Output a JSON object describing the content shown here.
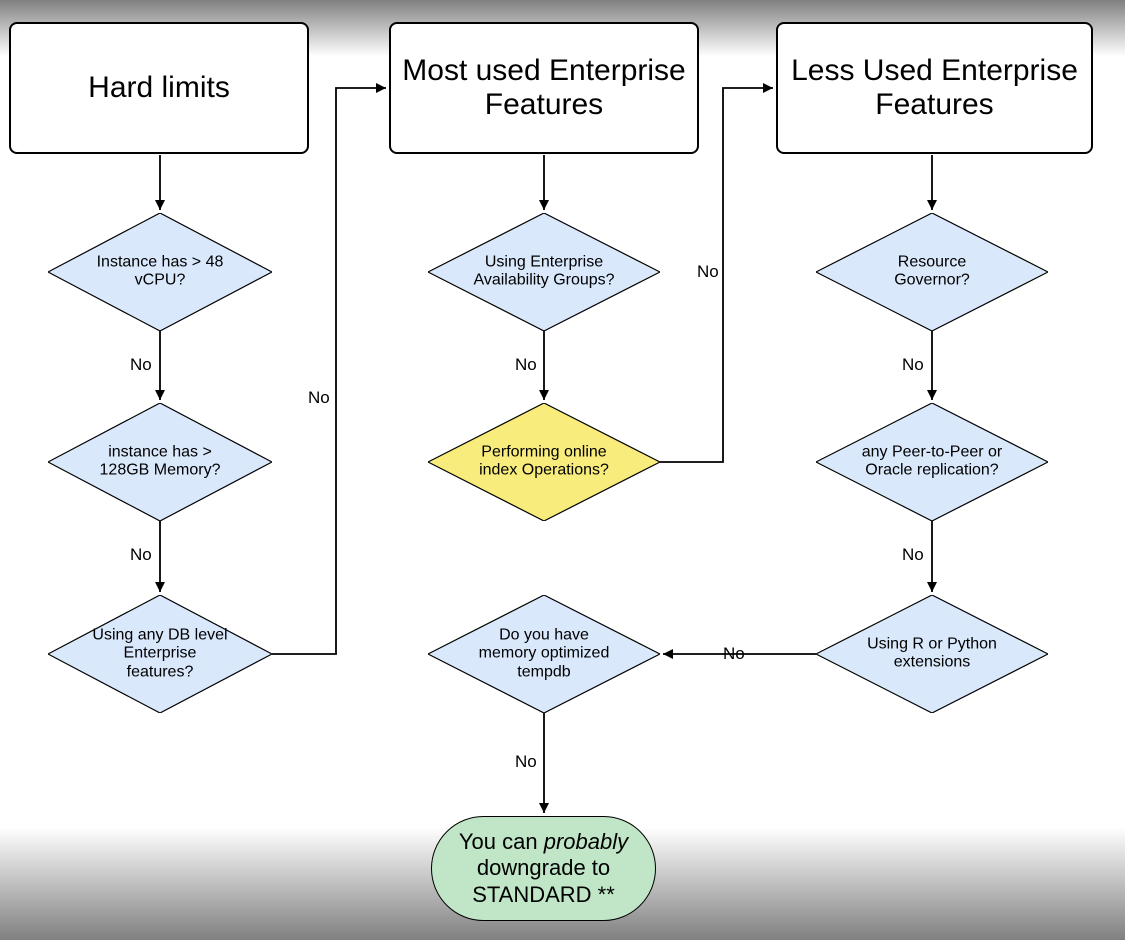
{
  "headers": {
    "col1": "Hard limits",
    "col2": "Most used Enterprise Features",
    "col3": "Less Used Enterprise Features"
  },
  "nodes": {
    "d_vcpu": "Instance has > 48 vCPU?",
    "d_mem": "instance has > 128GB Memory?",
    "d_dblevel": "Using any DB level Enterprise features?",
    "d_ag": "Using Enterprise Availability Groups?",
    "d_online": "Performing online index Operations?",
    "d_tempdb": "Do you have memory optimized tempdb",
    "d_rg": "Resource Governor?",
    "d_p2p": "any Peer-to-Peer or Oracle replication?",
    "d_rpy": "Using R or Python extensions",
    "term_pre": "You can ",
    "term_em": "probably",
    "term_post": " downgrade to STANDARD **"
  },
  "labels": {
    "no": "No"
  }
}
